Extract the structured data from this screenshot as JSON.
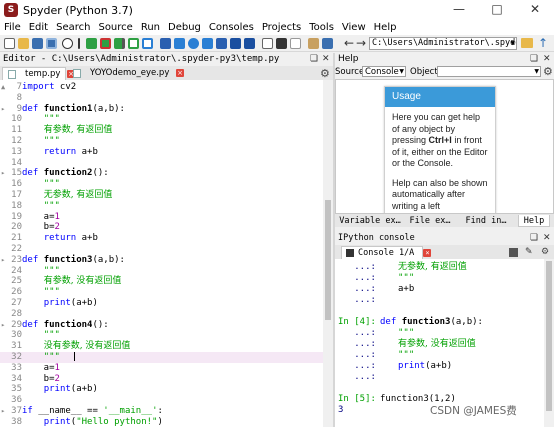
{
  "window": {
    "title": "Spyder (Python 3.7)"
  },
  "menu": [
    "File",
    "Edit",
    "Search",
    "Source",
    "Run",
    "Debug",
    "Consoles",
    "Projects",
    "Tools",
    "View",
    "Help"
  ],
  "toolbar": {
    "working_dir": "C:\\Users\\Administrator\\.spyder-py3"
  },
  "editor": {
    "header": "Editor - C:\\Users\\Administrator\\.spyder-py3\\temp.py",
    "tabs": [
      {
        "label": "temp.py",
        "active": true
      },
      {
        "label": "YOYOdemo_eye.py",
        "active": false
      }
    ],
    "current_line": 32,
    "lines": [
      {
        "n": "7",
        "fold": "▲",
        "tokens": [
          [
            "kw",
            "import"
          ],
          [
            "plain",
            " cv2"
          ]
        ]
      },
      {
        "n": "8",
        "tokens": []
      },
      {
        "n": "9",
        "fold": "▸",
        "tokens": [
          [
            "kw",
            "def"
          ],
          [
            "plain",
            " "
          ],
          [
            "fn",
            "function1"
          ],
          [
            "plain",
            "(a,b):"
          ]
        ]
      },
      {
        "n": "10",
        "tokens": [
          [
            "plain",
            "    "
          ],
          [
            "str",
            "\"\"\""
          ]
        ]
      },
      {
        "n": "11",
        "tokens": [
          [
            "plain",
            "    "
          ],
          [
            "cjk",
            "有参数, 有返回值"
          ]
        ]
      },
      {
        "n": "12",
        "tokens": [
          [
            "plain",
            "    "
          ],
          [
            "str",
            "\"\"\""
          ]
        ]
      },
      {
        "n": "13",
        "tokens": [
          [
            "plain",
            "    "
          ],
          [
            "kw",
            "return"
          ],
          [
            "plain",
            " a+b"
          ]
        ]
      },
      {
        "n": "14",
        "tokens": []
      },
      {
        "n": "15",
        "fold": "▸",
        "tokens": [
          [
            "kw",
            "def"
          ],
          [
            "plain",
            " "
          ],
          [
            "fn",
            "function2"
          ],
          [
            "plain",
            "():"
          ]
        ]
      },
      {
        "n": "16",
        "tokens": [
          [
            "plain",
            "    "
          ],
          [
            "str",
            "\"\"\""
          ]
        ]
      },
      {
        "n": "17",
        "tokens": [
          [
            "plain",
            "    "
          ],
          [
            "cjk",
            "无参数, 有返回值"
          ]
        ]
      },
      {
        "n": "18",
        "tokens": [
          [
            "plain",
            "    "
          ],
          [
            "str",
            "\"\"\""
          ]
        ]
      },
      {
        "n": "19",
        "tokens": [
          [
            "plain",
            "    a="
          ],
          [
            "num",
            "1"
          ]
        ]
      },
      {
        "n": "20",
        "tokens": [
          [
            "plain",
            "    b="
          ],
          [
            "num",
            "2"
          ]
        ]
      },
      {
        "n": "21",
        "tokens": [
          [
            "plain",
            "    "
          ],
          [
            "kw",
            "return"
          ],
          [
            "plain",
            " a+b"
          ]
        ]
      },
      {
        "n": "22",
        "tokens": []
      },
      {
        "n": "23",
        "fold": "▸",
        "tokens": [
          [
            "kw",
            "def"
          ],
          [
            "plain",
            " "
          ],
          [
            "fn",
            "function3"
          ],
          [
            "plain",
            "(a,b):"
          ]
        ]
      },
      {
        "n": "24",
        "tokens": [
          [
            "plain",
            "    "
          ],
          [
            "str",
            "\"\"\""
          ]
        ]
      },
      {
        "n": "25",
        "tokens": [
          [
            "plain",
            "    "
          ],
          [
            "cjk",
            "有参数, 没有返回值"
          ]
        ]
      },
      {
        "n": "26",
        "tokens": [
          [
            "plain",
            "    "
          ],
          [
            "str",
            "\"\"\""
          ]
        ]
      },
      {
        "n": "27",
        "tokens": [
          [
            "plain",
            "    "
          ],
          [
            "kw",
            "print"
          ],
          [
            "plain",
            "(a+b)"
          ]
        ]
      },
      {
        "n": "28",
        "tokens": []
      },
      {
        "n": "29",
        "fold": "▸",
        "tokens": [
          [
            "kw",
            "def"
          ],
          [
            "plain",
            " "
          ],
          [
            "fn",
            "function4"
          ],
          [
            "plain",
            "():"
          ]
        ]
      },
      {
        "n": "30",
        "tokens": [
          [
            "plain",
            "    "
          ],
          [
            "str",
            "\"\"\""
          ]
        ]
      },
      {
        "n": "31",
        "tokens": [
          [
            "plain",
            "    "
          ],
          [
            "cjk",
            "没有参数, 没有返回值"
          ]
        ]
      },
      {
        "n": "32",
        "tokens": [
          [
            "plain",
            "    "
          ],
          [
            "str",
            "\"\"\""
          ]
        ]
      },
      {
        "n": "33",
        "tokens": [
          [
            "plain",
            "    a="
          ],
          [
            "num",
            "1"
          ]
        ]
      },
      {
        "n": "34",
        "tokens": [
          [
            "plain",
            "    b="
          ],
          [
            "num",
            "2"
          ]
        ]
      },
      {
        "n": "35",
        "tokens": [
          [
            "plain",
            "    "
          ],
          [
            "kw",
            "print"
          ],
          [
            "plain",
            "(a+b)"
          ]
        ]
      },
      {
        "n": "36",
        "tokens": []
      },
      {
        "n": "37",
        "fold": "▸",
        "tokens": [
          [
            "kw",
            "if"
          ],
          [
            "plain",
            " __name__ == "
          ],
          [
            "str",
            "'__main__'"
          ],
          [
            "plain",
            ":"
          ]
        ]
      },
      {
        "n": "38",
        "tokens": [
          [
            "plain",
            "    "
          ],
          [
            "kw",
            "print"
          ],
          [
            "plain",
            "("
          ],
          [
            "str",
            "\"Hello python!\""
          ],
          [
            "plain",
            ")"
          ]
        ]
      }
    ]
  },
  "help": {
    "title": "Help",
    "source_label": "Source",
    "source_value": "Console",
    "object_label": "Object",
    "usage_title": "Usage",
    "usage_p1_a": "Here you can get help of any object by pressing",
    "usage_p1_key": "Ctrl+I",
    "usage_p1_b": "in front of it, either on the Editor or the Console.",
    "usage_p2": "Help can also be shown automatically after writing a left parenthesis next to an object. You",
    "tabs": [
      "Variable ex…",
      "File ex…",
      "Find in…",
      "Help"
    ]
  },
  "console": {
    "title": "IPython console",
    "tab_label": "Console 1/A",
    "lines": [
      {
        "prompt": "   ...:",
        "text": "",
        "cjk": "无参数, 有返回值"
      },
      {
        "prompt": "   ...:",
        "text": "\"\"\"",
        "str": true
      },
      {
        "prompt": "   ...:",
        "text": "a+b"
      },
      {
        "prompt": "   ...:",
        "text": ""
      },
      {
        "prompt": "",
        "text": ""
      },
      {
        "prompt": "In [4]:",
        "def_line": true,
        "text": "function3(a,b):"
      },
      {
        "prompt": "   ...:",
        "text": "\"\"\"",
        "str": true
      },
      {
        "prompt": "   ...:",
        "text": "",
        "cjk": "有参数, 没有返回值"
      },
      {
        "prompt": "   ...:",
        "text": "\"\"\"",
        "str": true
      },
      {
        "prompt": "   ...:",
        "text": "print(a+b)",
        "print": true
      },
      {
        "prompt": "   ...:",
        "text": ""
      },
      {
        "prompt": "",
        "text": ""
      },
      {
        "prompt": "In [5]:",
        "call": "function3(1,2)"
      },
      {
        "prompt": "3",
        "text": ""
      }
    ]
  },
  "watermark": "CSDN @JAMES费",
  "colors": {
    "usage_header": "#3b9ad9",
    "keyword": "#0000ff",
    "string": "#00a000",
    "number": "#a000a0",
    "current_line": "#f5e8f5"
  }
}
